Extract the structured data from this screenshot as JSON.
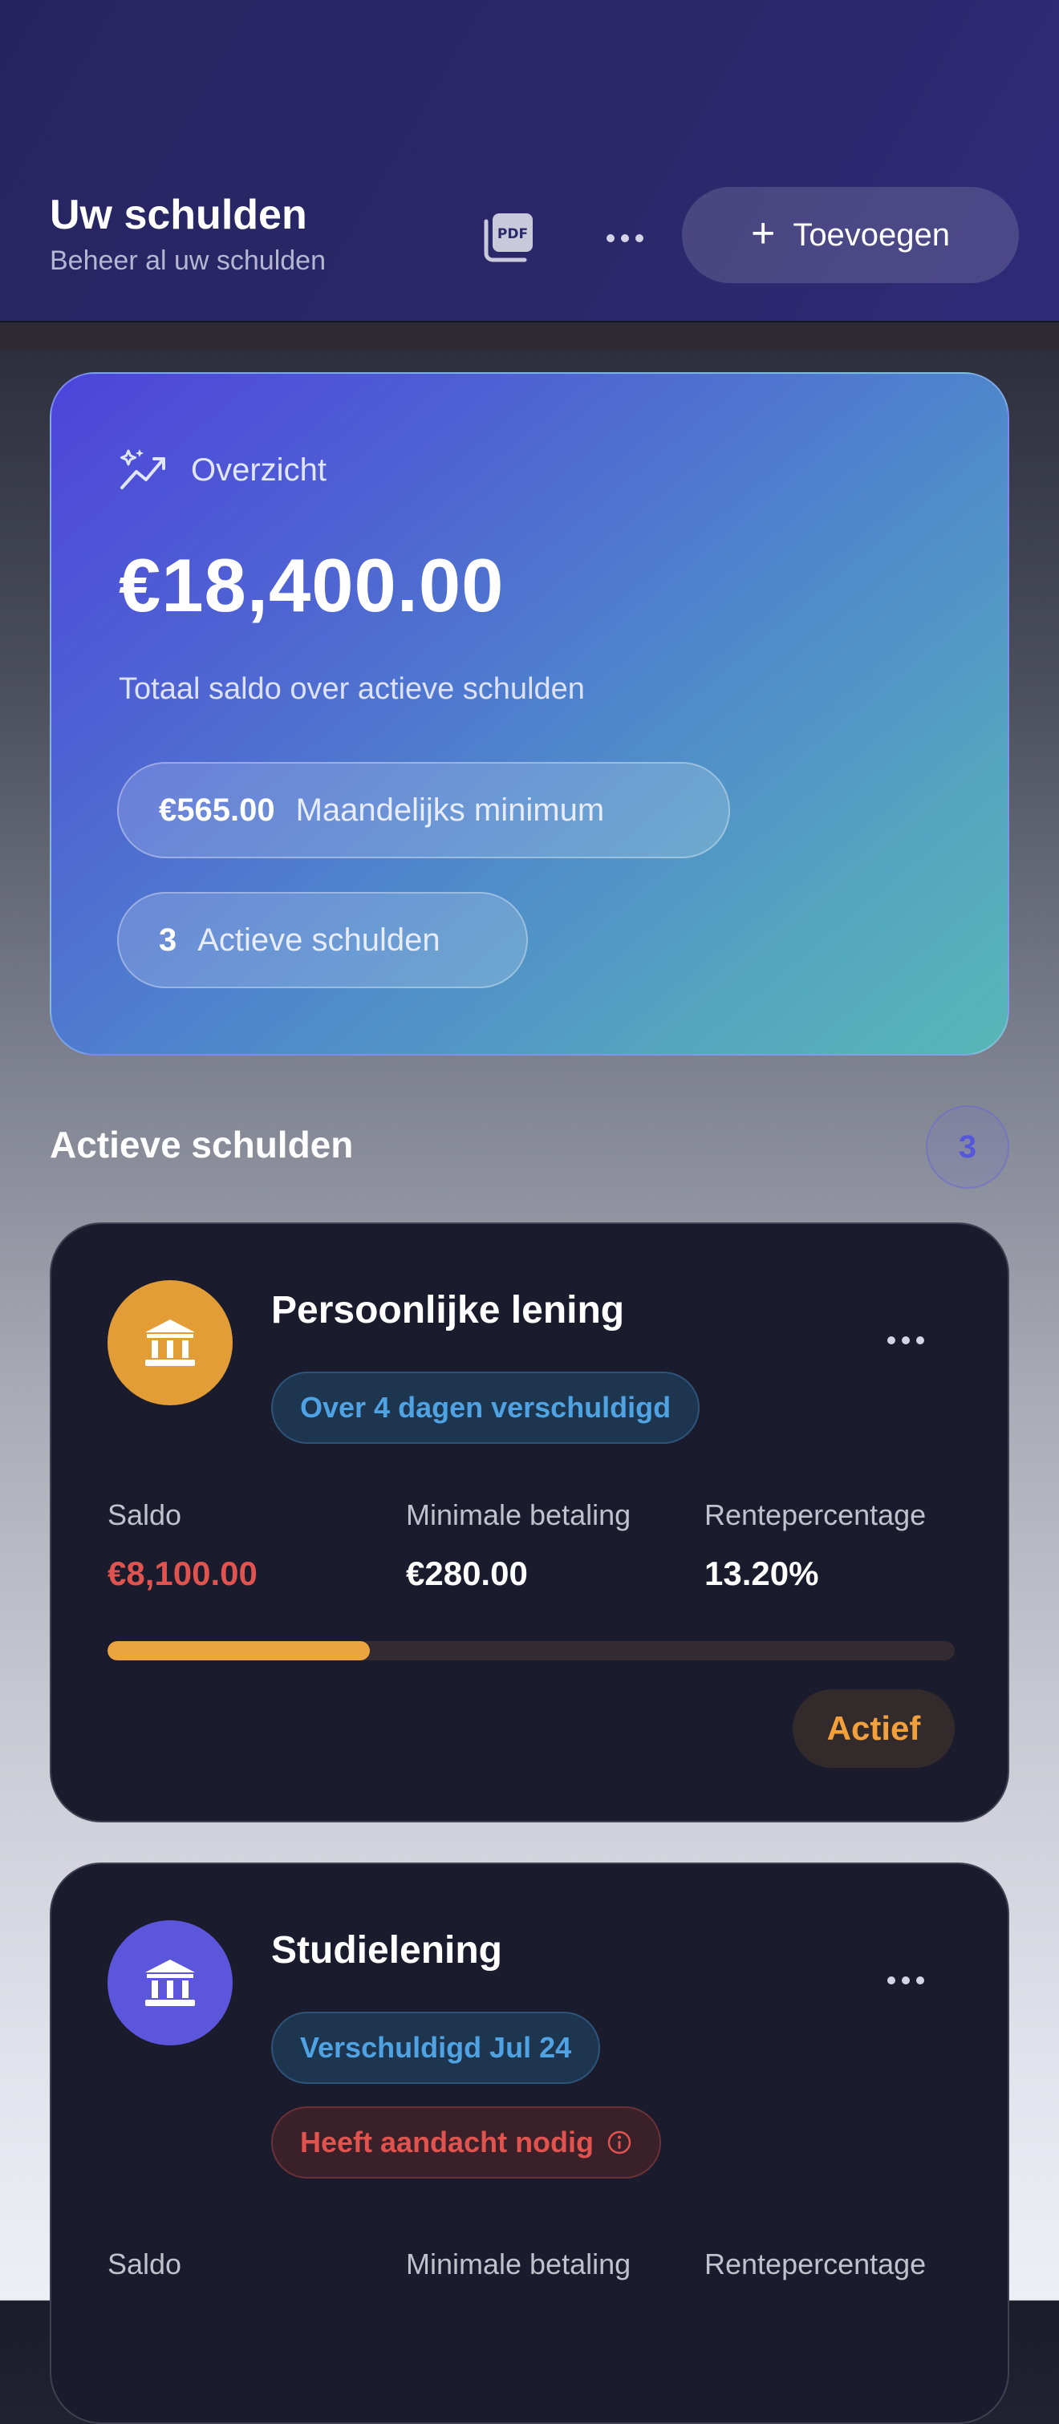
{
  "header": {
    "title": "Uw schulden",
    "subtitle": "Beheer al uw schulden",
    "add_label": "Toevoegen"
  },
  "overview": {
    "label": "Overzicht",
    "total": "€18,400.00",
    "description": "Totaal saldo over actieve schulden",
    "monthly_value": "€565.00",
    "monthly_label": "Maandelijks minimum",
    "active_count": "3",
    "active_label": "Actieve schulden"
  },
  "section": {
    "title": "Actieve schulden",
    "count": "3"
  },
  "debts": [
    {
      "name": "Persoonlijke lening",
      "icon": "bank-icon",
      "icon_color": "#e39d36",
      "tags": [
        "Over 4 dagen verschuldigd"
      ],
      "balance_label": "Saldo",
      "balance": "€8,100.00",
      "balance_color": "#e0534f",
      "min_payment_label": "Minimale betaling",
      "min_payment": "€280.00",
      "rate_label": "Rentepercentage",
      "rate": "13.20%",
      "progress": 0.31,
      "status": "Actief"
    },
    {
      "name": "Studielening",
      "icon": "bank-icon",
      "icon_color": "#5c56dd",
      "tags": [
        "Verschuldigd Jul 24",
        "Heeft aandacht nodig"
      ],
      "balance_label": "Saldo",
      "min_payment_label": "Minimale betaling",
      "rate_label": "Rentepercentage"
    }
  ],
  "colors": {
    "accent": "#4d44db",
    "warning": "#eba43f",
    "danger": "#e0534f",
    "info": "#4fa3e3"
  }
}
